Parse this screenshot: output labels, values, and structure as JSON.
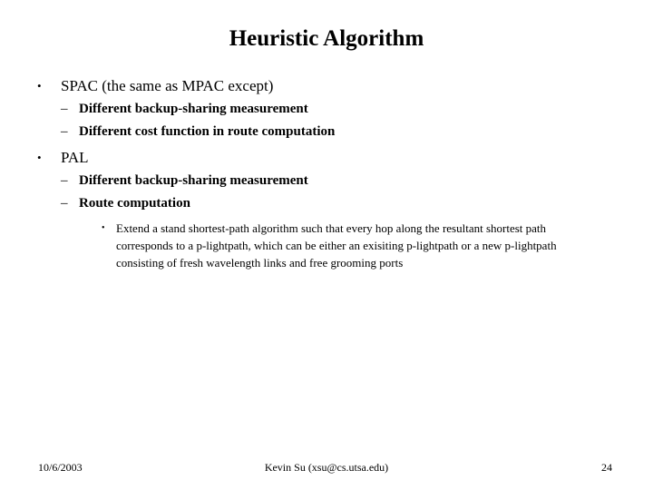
{
  "slide": {
    "title": "Heuristic Algorithm",
    "background_color": "#ffffff",
    "text_color": "#000000",
    "bullets": {
      "level1_marker": "•",
      "level2_marker": "–",
      "level3_marker": "•"
    },
    "content": [
      {
        "level": 1,
        "text": "SPAC (the same as MPAC except)"
      },
      {
        "level": 2,
        "text": "Different backup-sharing measurement"
      },
      {
        "level": 2,
        "text": "Different cost function in route computation"
      },
      {
        "level": 1,
        "text": "PAL"
      },
      {
        "level": 2,
        "text": "Different backup-sharing measurement"
      },
      {
        "level": 2,
        "text": "Route computation"
      },
      {
        "level": 3,
        "text": "Extend a stand shortest-path algorithm such that every hop along  the resultant shortest path corresponds to a  p-lightpath, which can be either an exisiting p-lightpath or a new p-lightpath consisting of fresh wavelength links and free grooming ports"
      }
    ]
  },
  "footer": {
    "date": "10/6/2003",
    "author": "Kevin Su (xsu@cs.utsa.edu)",
    "page_number": "24"
  }
}
